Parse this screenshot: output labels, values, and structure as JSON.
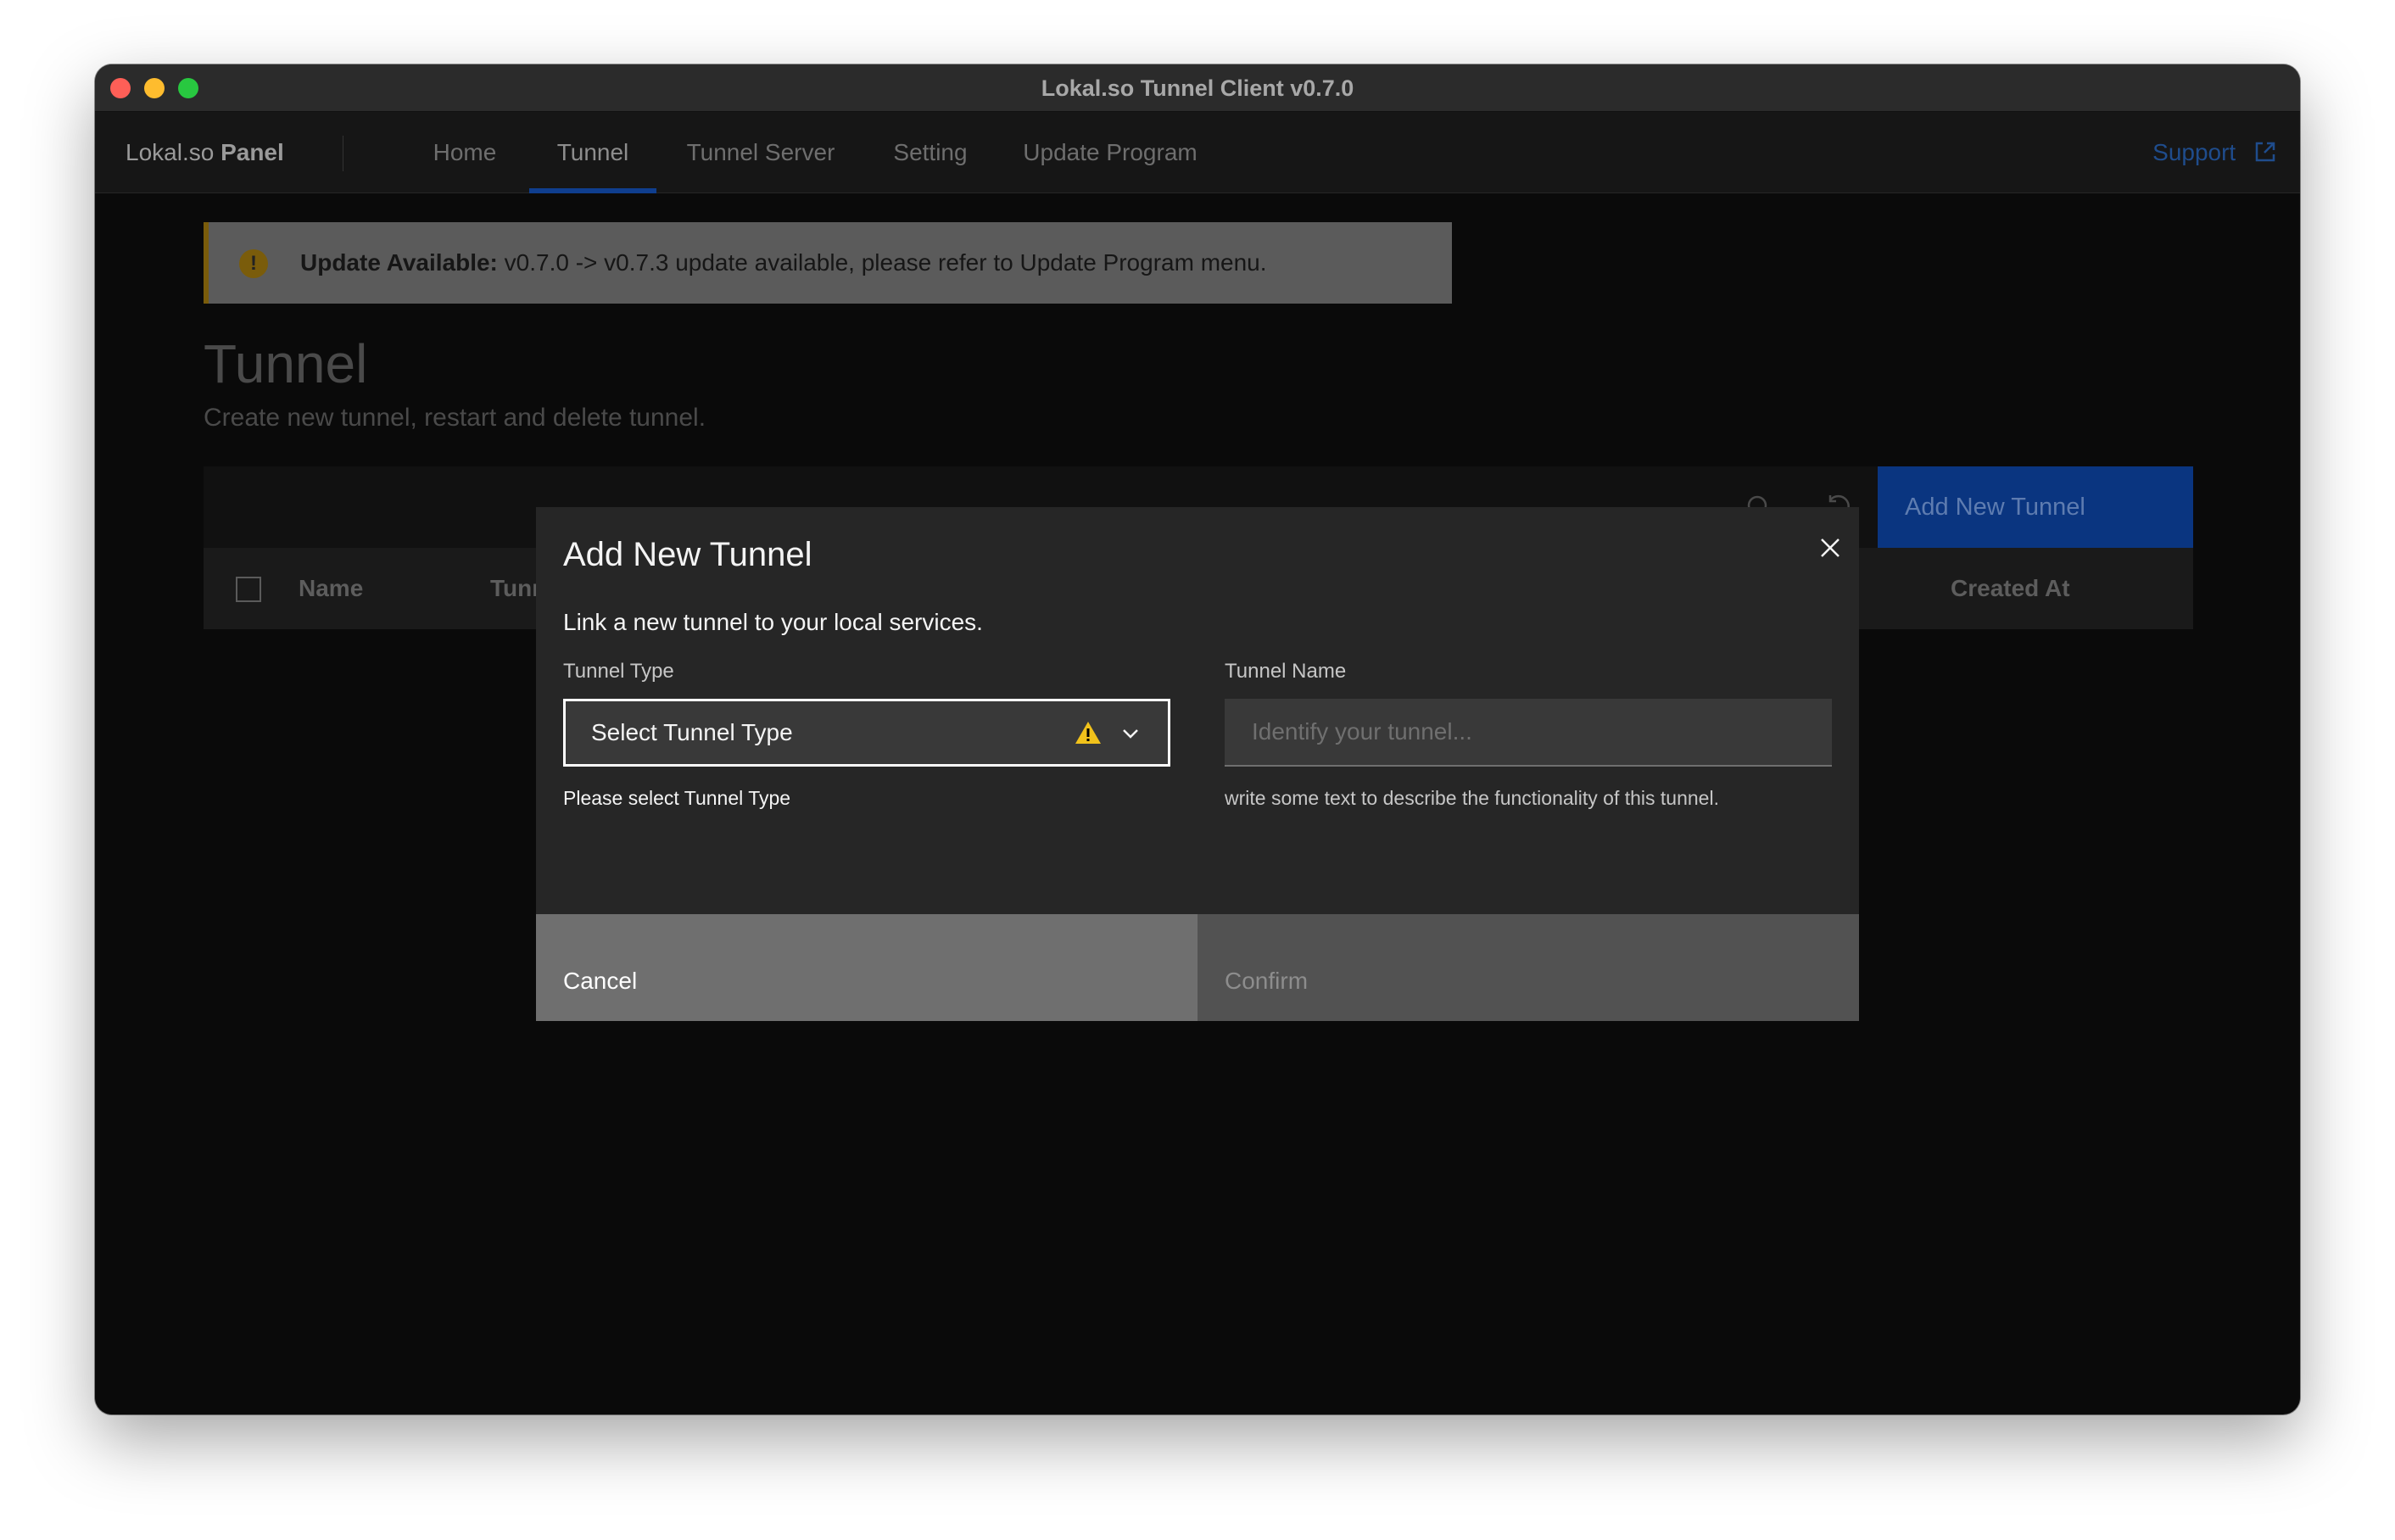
{
  "window": {
    "title": "Lokal.so Tunnel Client v0.7.0"
  },
  "header": {
    "brand_prefix": "Lokal.so",
    "brand_bold": "Panel",
    "nav": [
      {
        "label": "Home"
      },
      {
        "label": "Tunnel",
        "active": true
      },
      {
        "label": "Tunnel Server"
      },
      {
        "label": "Setting"
      },
      {
        "label": "Update Program"
      }
    ],
    "support_label": "Support"
  },
  "notice": {
    "icon": "exclamation-icon",
    "bold": "Update Available:",
    "text": " v0.7.0 -> v0.7.3 update available, please refer to Update Program menu."
  },
  "page": {
    "title": "Tunnel",
    "subtitle": "Create new tunnel, restart and delete tunnel."
  },
  "toolbar": {
    "icons": [
      "search-icon",
      "refresh-icon",
      "settings-icon"
    ],
    "add_button_label": "Add New Tunnel"
  },
  "table": {
    "columns": [
      "Name",
      "Tunn",
      "Created At"
    ]
  },
  "modal": {
    "title": "Add New Tunnel",
    "description": "Link a new tunnel to your local services.",
    "tunnel_type": {
      "label": "Tunnel Type",
      "value": "Select Tunnel Type",
      "error": "Please select Tunnel Type"
    },
    "tunnel_name": {
      "label": "Tunnel Name",
      "placeholder": "Identify your tunnel...",
      "value": "",
      "helper": "write some text to describe the functionality of this tunnel."
    },
    "cancel_label": "Cancel",
    "confirm_label": "Confirm"
  },
  "colors": {
    "accent_blue": "#0f62fe",
    "warning_yellow": "#f1c21b",
    "modal_bg": "#262626"
  }
}
